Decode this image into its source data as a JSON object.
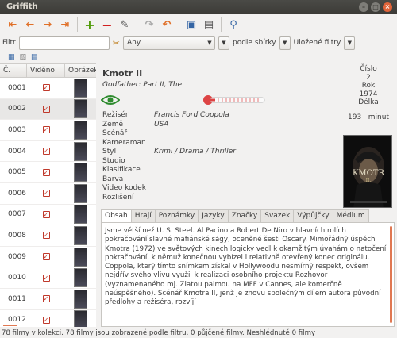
{
  "window": {
    "title": "Griffith"
  },
  "toolbar": {
    "icons": [
      "first-icon",
      "prev-icon",
      "next-icon",
      "last-icon",
      "add-icon",
      "remove-icon",
      "edit-icon",
      "loan-icon",
      "return-icon",
      "poster-icon",
      "export-icon",
      "search-icon"
    ]
  },
  "filter": {
    "label": "Filtr",
    "value": "",
    "field_combo": "Any",
    "sbirka_label": "podle sbírky",
    "ulozene_label": "Uložené filtry"
  },
  "table": {
    "headers": [
      "Č.",
      "Viděno",
      "Obrázek"
    ],
    "rows": [
      {
        "num": "0001",
        "seen": true
      },
      {
        "num": "0002",
        "seen": true
      },
      {
        "num": "0003",
        "seen": true
      },
      {
        "num": "0004",
        "seen": true
      },
      {
        "num": "0005",
        "seen": true
      },
      {
        "num": "0006",
        "seen": true
      },
      {
        "num": "0007",
        "seen": true
      },
      {
        "num": "0008",
        "seen": true
      },
      {
        "num": "0009",
        "seen": true
      },
      {
        "num": "0010",
        "seen": true
      },
      {
        "num": "0011",
        "seen": true
      },
      {
        "num": "0012",
        "seen": true
      }
    ]
  },
  "movie": {
    "title": "Kmotr II",
    "original_title": "Godfather: Part II, The",
    "props": [
      {
        "label": "Režisér",
        "value": "Francis Ford Coppola"
      },
      {
        "label": "Země",
        "value": "USA"
      },
      {
        "label": "Scénář",
        "value": ""
      },
      {
        "label": "Kameraman",
        "value": ""
      },
      {
        "label": "Styl",
        "value": "Krimi / Drama / Thriller"
      },
      {
        "label": "Studio",
        "value": ""
      },
      {
        "label": "Klasifikace",
        "value": ""
      },
      {
        "label": "Barva",
        "value": ""
      },
      {
        "label": "Video kodek",
        "value": ""
      },
      {
        "label": "Rozlišení",
        "value": ""
      }
    ],
    "cislo_label": "Číslo",
    "cislo": "2",
    "rok_label": "Rok",
    "rok": "1974",
    "delka_label": "Délka",
    "delka": "193",
    "minut": "minut",
    "poster_text": "KMOTR",
    "poster_sub": "II."
  },
  "tabs": [
    "Obsah",
    "Hrají",
    "Poznámky",
    "Jazyky",
    "Značky",
    "Svazek",
    "Výpůjčky",
    "Médium"
  ],
  "plot": "Jsme větší než U. S. Steel. Al Pacino a Robert De Niro v hlavních rolích pokračování slavné mafiánské ságy, oceněné šesti Oscary. Mimořádný úspěch Kmotra (1972) ve světových kinech logicky vedl k okamžitým úvahám o natočení pokračování, k němuž konečnou vybízel i relativně otevřený konec originálu. Coppola, který tímto snímkem získal v Hollywoodu nesmírný respekt, ovšem nejdřív svého vlivu využil k realizaci osobního projektu Rozhovor (vyznamenaného mj. Zlatou palmou na MFF v Cannes, ale komerčně neúspěšného). Scénář Kmotra II, jenž je znovu společným dílem autora původní předlohy a režiséra, rozvíjí",
  "status": "78 filmy v kolekci. 78 filmy jsou  zobrazené podle filtru. 0 půjčené filmy. Neshlédnuté 0 filmy"
}
